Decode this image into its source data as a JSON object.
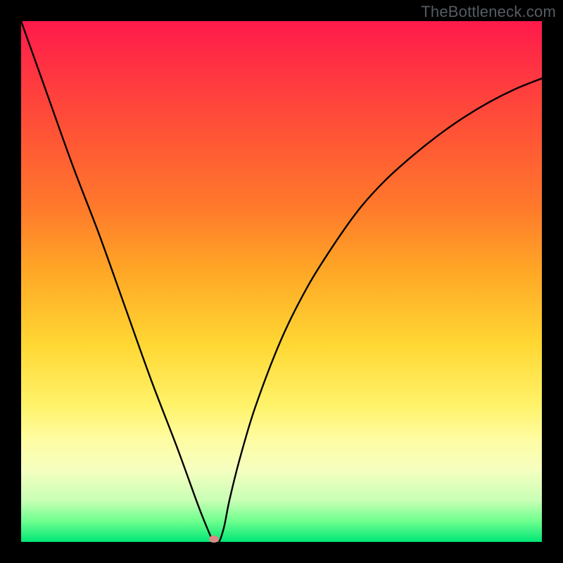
{
  "branding": "TheBottleneck.com",
  "chart_data": {
    "type": "line",
    "title": "",
    "xlabel": "",
    "ylabel": "",
    "xlim": [
      0,
      100
    ],
    "ylim": [
      0,
      100
    ],
    "grid": false,
    "legend": false,
    "series": [
      {
        "name": "bottleneck-curve",
        "x": [
          0,
          5,
          10,
          15,
          20,
          25,
          30,
          34,
          36,
          37,
          38,
          39,
          40,
          42,
          45,
          50,
          55,
          60,
          65,
          70,
          75,
          80,
          85,
          90,
          95,
          100
        ],
        "values": [
          100,
          86,
          72,
          59,
          45,
          31,
          18,
          7,
          2,
          0,
          0,
          3,
          8,
          16,
          26,
          39,
          49,
          57,
          64,
          69.5,
          74,
          78,
          81.5,
          84.5,
          87,
          89
        ]
      }
    ],
    "minimum_point": {
      "x": 37,
      "y": 0
    },
    "background_gradient": {
      "top": "#ff1a4b",
      "mid": "#ffd733",
      "bottom": "#00e676"
    },
    "curve_color": "#000000",
    "marker_color": "#d88a86"
  }
}
